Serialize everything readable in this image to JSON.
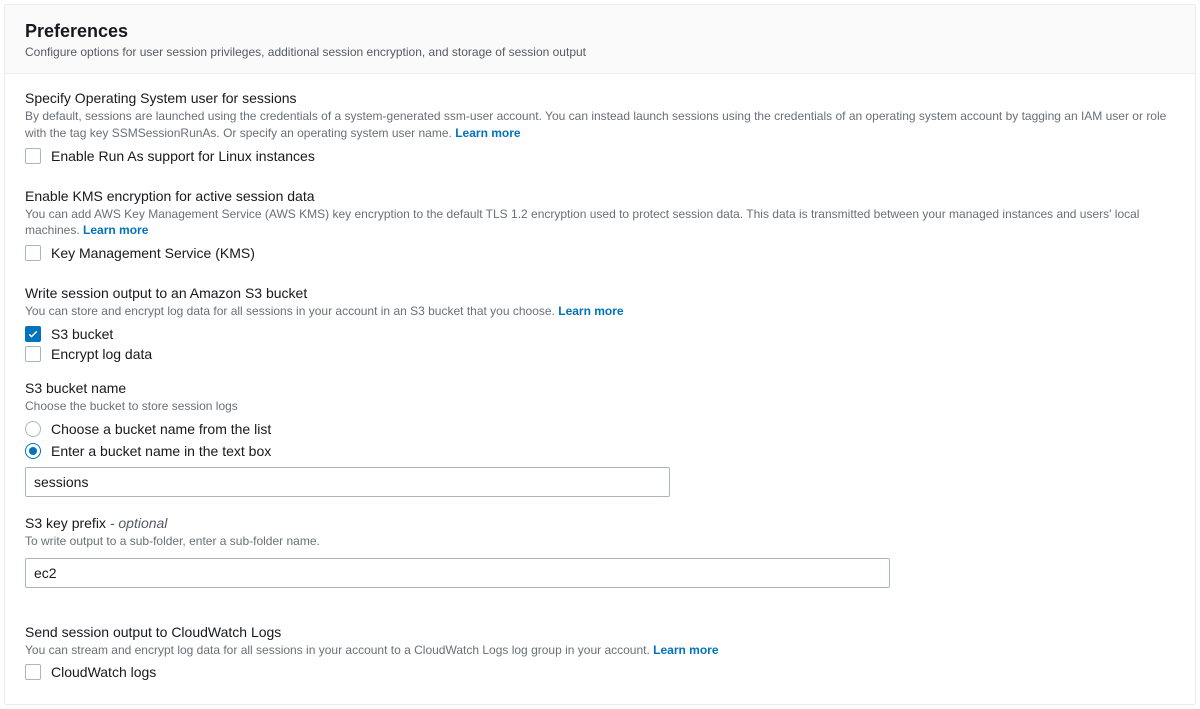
{
  "header": {
    "title": "Preferences",
    "subtitle": "Configure options for user session privileges, additional session encryption, and storage of session output"
  },
  "learn_more_label": "Learn more",
  "sections": {
    "os_user": {
      "title": "Specify Operating System user for sessions",
      "description": "By default, sessions are launched using the credentials of a system-generated ssm-user account. You can instead launch sessions using the credentials of an operating system account by tagging an IAM user or role with the tag key SSMSessionRunAs. Or specify an operating system user name.",
      "checkbox_label": "Enable Run As support for Linux instances",
      "checked": false
    },
    "kms": {
      "title": "Enable KMS encryption for active session data",
      "description": "You can add AWS Key Management Service (AWS KMS) key encryption to the default TLS 1.2 encryption used to protect session data. This data is transmitted between your managed instances and users' local machines.",
      "checkbox_label": "Key Management Service (KMS)",
      "checked": false
    },
    "s3": {
      "title": "Write session output to an Amazon S3 bucket",
      "description": "You can store and encrypt log data for all sessions in your account in an S3 bucket that you choose.",
      "bucket_checkbox_label": "S3 bucket",
      "bucket_checked": true,
      "encrypt_checkbox_label": "Encrypt log data",
      "encrypt_checked": false,
      "bucket_name": {
        "title": "S3 bucket name",
        "description": "Choose the bucket to store session logs",
        "radio_list_label": "Choose a bucket name from the list",
        "radio_text_label": "Enter a bucket name in the text box",
        "selected": "text",
        "value": "sessions"
      },
      "key_prefix": {
        "title": "S3 key prefix",
        "optional_label": "- optional",
        "description": "To write output to a sub-folder, enter a sub-folder name.",
        "value": "ec2"
      }
    },
    "cloudwatch": {
      "title": "Send session output to CloudWatch Logs",
      "description": "You can stream and encrypt log data for all sessions in your account to a CloudWatch Logs log group in your account.",
      "checkbox_label": "CloudWatch logs",
      "checked": false
    }
  }
}
